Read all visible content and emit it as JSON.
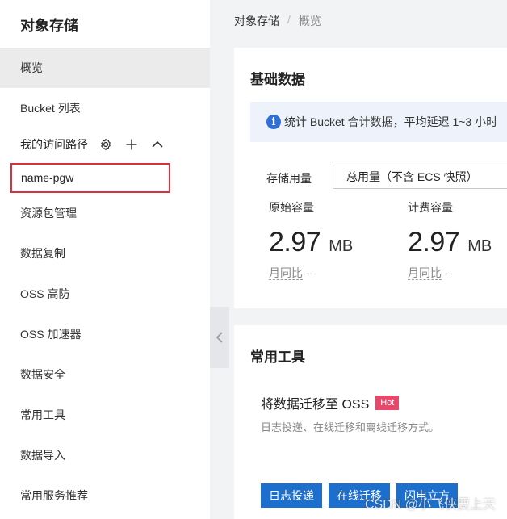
{
  "sidebar": {
    "title": "对象存储",
    "items": [
      {
        "label": "概览",
        "active": true
      },
      {
        "label": "Bucket 列表"
      }
    ],
    "access_path": {
      "label": "我的访问路径",
      "icons": [
        "gear-icon",
        "plus-icon",
        "chevron-up-icon"
      ],
      "items": [
        "name-pgw"
      ]
    },
    "menu": [
      "资源包管理",
      "数据复制",
      "OSS 高防",
      "OSS 加速器",
      "数据安全",
      "常用工具",
      "数据导入",
      "常用服务推荐"
    ]
  },
  "breadcrumb": {
    "root": "对象存储",
    "separator": "/",
    "current": "概览"
  },
  "basic_data": {
    "title": "基础数据",
    "info": "统计 Bucket 合计数据，平均延迟 1~3 小时",
    "storage_label": "存储用量",
    "storage_select": "总用量（不含 ECS 快照）",
    "metrics": [
      {
        "label": "原始容量",
        "value": "2.97",
        "unit": "MB",
        "yoy_label": "月同比",
        "yoy_value": "--"
      },
      {
        "label": "计费容量",
        "value": "2.97",
        "unit": "MB",
        "yoy_label": "月同比",
        "yoy_value": "--"
      }
    ]
  },
  "tools": {
    "title": "常用工具",
    "item_title": "将数据迁移至 OSS",
    "badge": "Hot",
    "desc": "日志投递、在线迁移和离线迁移方式。",
    "buttons": [
      "日志投递",
      "在线迁移",
      "闪电立方"
    ]
  },
  "watermark": "CSDN @小飞侠要上天",
  "colors": {
    "accent": "#1d6fce",
    "highlight_border": "#d9303a",
    "hot_badge": "#e8496b",
    "info_bg": "#eef3fb"
  }
}
